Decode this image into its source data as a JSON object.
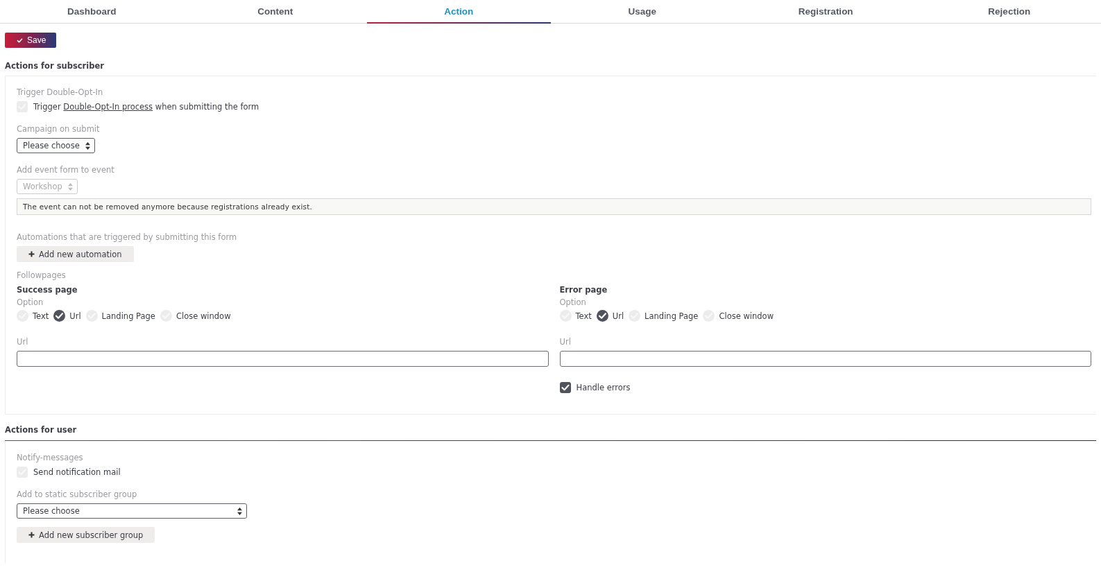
{
  "tabs": [
    {
      "label": "Dashboard",
      "selected": false
    },
    {
      "label": "Content",
      "selected": false
    },
    {
      "label": "Action",
      "selected": true
    },
    {
      "label": "Usage",
      "selected": false
    },
    {
      "label": "Registration",
      "selected": false
    },
    {
      "label": "Rejection",
      "selected": false
    }
  ],
  "save_button": {
    "label": "Save"
  },
  "subscriber_section": {
    "title": "Actions for subscriber",
    "double_opt_in": {
      "label": "Trigger Double-Opt-In",
      "checked": true,
      "disabled": true,
      "text_before": "Trigger ",
      "link": "Double-Opt-In process",
      "text_after": " when submitting the form"
    },
    "campaign": {
      "label": "Campaign on submit",
      "value": "Please choose",
      "disabled": false
    },
    "event": {
      "label": "Add event form to event",
      "value": "Workshop",
      "disabled": true,
      "notice": "The event can not be removed anymore because registrations already exist."
    },
    "automations": {
      "label": "Automations that are triggered by submitting this form",
      "button": "Add new automation"
    },
    "followpages": {
      "label": "Followpages",
      "pages": [
        {
          "title": "Success page",
          "option_label": "Option",
          "options": [
            {
              "label": "Text",
              "selected": false
            },
            {
              "label": "Url",
              "selected": true
            },
            {
              "label": "Landing Page",
              "selected": false
            },
            {
              "label": "Close window",
              "selected": false
            }
          ],
          "url_label": "Url"
        },
        {
          "title": "Error page",
          "option_label": "Option",
          "options": [
            {
              "label": "Text",
              "selected": false
            },
            {
              "label": "Url",
              "selected": true
            },
            {
              "label": "Landing Page",
              "selected": false
            },
            {
              "label": "Close window",
              "selected": false
            }
          ],
          "url_label": "Url",
          "handle_errors": {
            "label": "Handle errors",
            "checked": true,
            "disabled": false
          }
        }
      ]
    }
  },
  "user_section": {
    "title": "Actions for user",
    "notify": {
      "label": "Notify-messages",
      "checkbox_label": "Send notification mail",
      "checked": true,
      "disabled": true
    },
    "group": {
      "label": "Add to static subscriber group",
      "value": "Please choose",
      "disabled": false,
      "button": "Add new subscriber group"
    }
  }
}
